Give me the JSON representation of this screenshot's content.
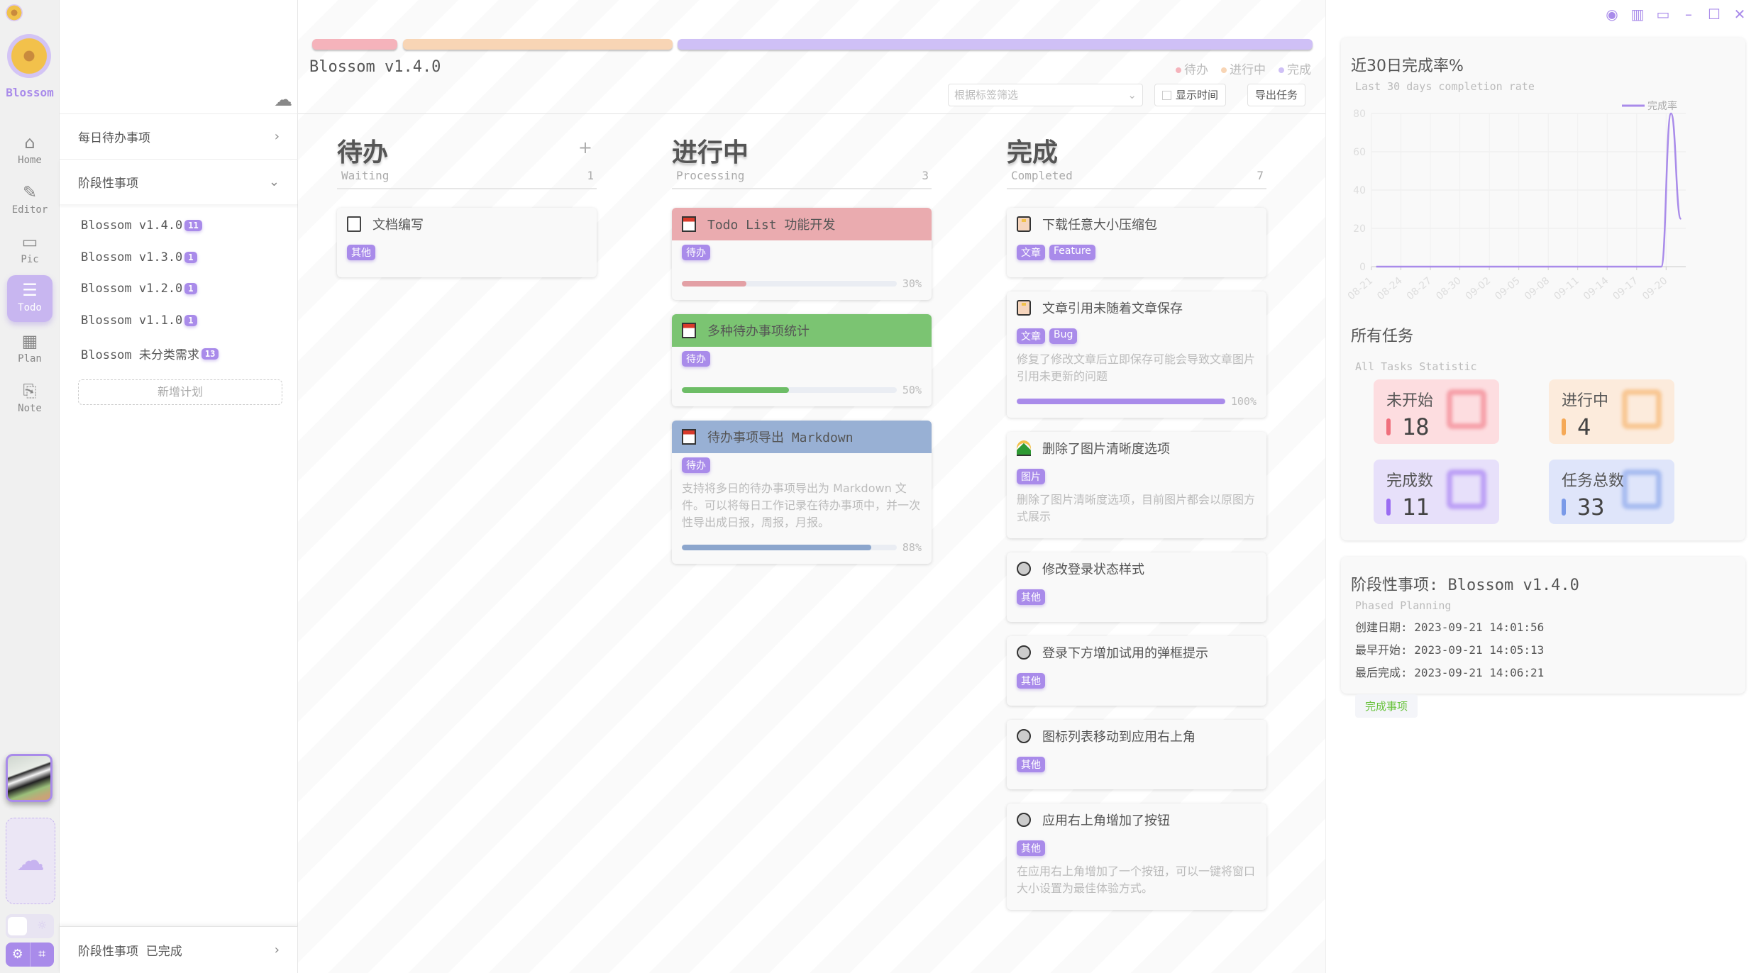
{
  "app": {
    "brand": "Blossom"
  },
  "rail": {
    "items": [
      {
        "label": "Home",
        "icon": "⌂"
      },
      {
        "label": "Editor",
        "icon": "✎"
      },
      {
        "label": "Pic",
        "icon": "▭"
      },
      {
        "label": "Todo",
        "icon": "☰"
      },
      {
        "label": "Plan",
        "icon": "▦"
      },
      {
        "label": "Note",
        "icon": "⎘"
      }
    ]
  },
  "sidebar": {
    "daily": "每日待办事项",
    "phased": "阶段性事项",
    "plans": [
      {
        "name": "Blossom v1.4.0",
        "count": "11"
      },
      {
        "name": "Blossom v1.3.0",
        "count": "1"
      },
      {
        "name": "Blossom v1.2.0",
        "count": "1"
      },
      {
        "name": "Blossom v1.1.0",
        "count": "1"
      },
      {
        "name": "Blossom 未分类需求",
        "count": "13"
      }
    ],
    "new_plan": "新增计划",
    "completed": "阶段性事项  已完成"
  },
  "toolbar": {
    "title": "Blossom v1.4.0",
    "legend": [
      "待办",
      "进行中",
      "完成"
    ],
    "filter_placeholder": "根据标签筛选",
    "show_time": "显示时间",
    "export": "导出任务"
  },
  "colors": {
    "waiting": "#f5b3bb",
    "processing": "#f8d5b5",
    "completed": "#cfc0f6",
    "accent": "#a98bea"
  },
  "overall_progress": {
    "waiting": 1,
    "processing": 3,
    "completed": 7
  },
  "columns": [
    {
      "title": "待办",
      "subtitle": "Waiting",
      "count": "1",
      "cards": [
        {
          "title": "文档编写",
          "icon": "doc",
          "tags": [
            "其他"
          ]
        }
      ]
    },
    {
      "title": "进行中",
      "subtitle": "Processing",
      "count": "3",
      "cards": [
        {
          "title": "Todo List 功能开发",
          "icon": "cal",
          "color": "#eaabaf",
          "bar": "#e3a0a5",
          "tags": [
            "待办"
          ],
          "progress": 30
        },
        {
          "title": "多种待办事项统计",
          "icon": "cal",
          "color": "#7bc472",
          "bar": "#6dbd66",
          "tags": [
            "待办"
          ],
          "progress": 50
        },
        {
          "title": "待办事项导出 Markdown",
          "icon": "cal",
          "color": "#98b0d4",
          "bar": "#8ca6cd",
          "tags": [
            "待办"
          ],
          "desc": "支持将多日的待办事项导出为 Markdown 文件。可以将每日工作记录在待办事项中，并一次性导出成日报，周报，月报。",
          "progress": 88
        }
      ]
    },
    {
      "title": "完成",
      "subtitle": "Completed",
      "count": "7",
      "cards": [
        {
          "title": "下载任意大小压缩包",
          "icon": "note",
          "tags": [
            "文章",
            "Feature"
          ]
        },
        {
          "title": "文章引用未随着文章保存",
          "icon": "note",
          "tags": [
            "文章",
            "Bug"
          ],
          "desc": "修复了修改文章后立即保存可能会导致文章图片引用未更新的问题",
          "progress": 100,
          "bar": "#a98bea"
        },
        {
          "title": "删除了图片清晰度选项",
          "icon": "land",
          "tags": [
            "图片"
          ],
          "desc": "删除了图片清晰度选项，目前图片都会以原图方式展示"
        },
        {
          "title": "修改登录状态样式",
          "icon": "circ",
          "tags": [
            "其他"
          ]
        },
        {
          "title": "登录下方增加试用的弹框提示",
          "icon": "circ",
          "tags": [
            "其他"
          ]
        },
        {
          "title": "图标列表移动到应用右上角",
          "icon": "circ",
          "tags": [
            "其他"
          ]
        },
        {
          "title": "应用右上角增加了按钮",
          "icon": "circ",
          "tags": [
            "其他"
          ],
          "desc": "在应用右上角增加了一个按钮，可以一键将窗口大小设置为最佳体验方式。"
        }
      ]
    }
  ],
  "right": {
    "chart_title": "近30日完成率%",
    "chart_subtitle": "Last 30 days completion rate",
    "stats_title": "所有任务",
    "stats_subtitle": "All Tasks Statistic",
    "stats": [
      {
        "label": "未开始",
        "value": "18",
        "bg": "#fddde0",
        "mark": "#f06f7c"
      },
      {
        "label": "进行中",
        "value": "4",
        "bg": "#fcebdc",
        "mark": "#f5a957"
      },
      {
        "label": "完成数",
        "value": "11",
        "bg": "#e7e0fa",
        "mark": "#9a6cf2"
      },
      {
        "label": "任务总数",
        "value": "33",
        "bg": "#dfe5fa",
        "mark": "#7a9ae8"
      }
    ],
    "phase_title": "阶段性事项: Blossom v1.4.0",
    "phase_subtitle": "Phased Planning",
    "created": "创建日期: 2023-09-21 14:01:56",
    "earliest": "最早开始: 2023-09-21 14:05:13",
    "last": "最后完成: 2023-09-21 14:06:21",
    "done_button": "完成事项"
  },
  "chart_data": {
    "type": "line",
    "title": "近30日完成率%",
    "subtitle": "Last 30 days completion rate",
    "legend": [
      "完成率"
    ],
    "legend_position": "top-right",
    "ylim": [
      0,
      80
    ],
    "yticks": [
      0,
      20,
      40,
      60,
      80
    ],
    "grid": true,
    "x": [
      "08-21",
      "08-22",
      "08-23",
      "08-24",
      "08-25",
      "08-26",
      "08-27",
      "08-28",
      "08-29",
      "08-30",
      "08-31",
      "09-01",
      "09-02",
      "09-03",
      "09-04",
      "09-05",
      "09-06",
      "09-07",
      "09-08",
      "09-09",
      "09-10",
      "09-11",
      "09-12",
      "09-13",
      "09-14",
      "09-15",
      "09-16",
      "09-17",
      "09-18",
      "09-19",
      "09-20",
      "09-21"
    ],
    "xtick_labels": [
      "08-21",
      "08-24",
      "08-27",
      "08-30",
      "09-02",
      "09-05",
      "09-08",
      "09-11",
      "09-14",
      "09-17",
      "09-20"
    ],
    "series": [
      {
        "name": "完成率",
        "color": "#a98bea",
        "values": [
          0,
          0,
          0,
          0,
          0,
          0,
          0,
          0,
          0,
          0,
          0,
          0,
          0,
          0,
          0,
          0,
          0,
          0,
          0,
          0,
          0,
          0,
          0,
          0,
          0,
          0,
          0,
          0,
          0,
          0,
          80,
          25
        ]
      }
    ]
  }
}
